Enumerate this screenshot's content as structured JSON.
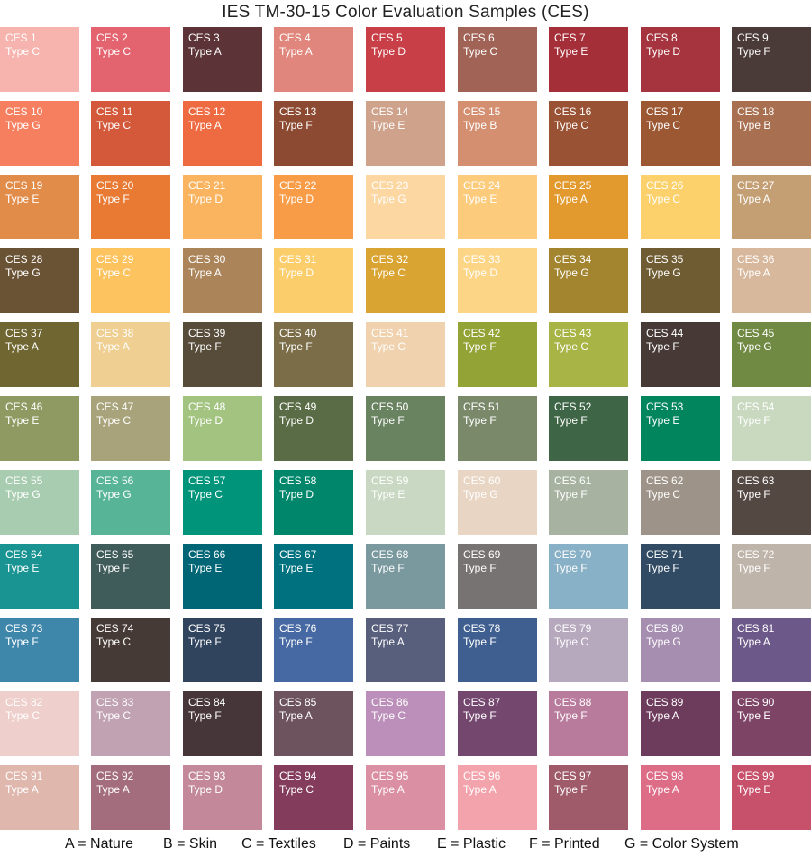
{
  "title": "IES TM-30-15 Color Evaluation Samples (CES)",
  "samples": [
    {
      "id": "CES 1",
      "type": "Type C",
      "color": "#f7b4ae"
    },
    {
      "id": "CES 2",
      "type": "Type C",
      "color": "#e3636f"
    },
    {
      "id": "CES 3",
      "type": "Type A",
      "color": "#5c3437"
    },
    {
      "id": "CES 4",
      "type": "Type A",
      "color": "#e0867c"
    },
    {
      "id": "CES 5",
      "type": "Type D",
      "color": "#c93f48"
    },
    {
      "id": "CES 6",
      "type": "Type C",
      "color": "#a06356"
    },
    {
      "id": "CES 7",
      "type": "Type E",
      "color": "#a52f39"
    },
    {
      "id": "CES 8",
      "type": "Type D",
      "color": "#a6343e"
    },
    {
      "id": "CES 9",
      "type": "Type F",
      "color": "#4a3a38"
    },
    {
      "id": "CES 10",
      "type": "Type G",
      "color": "#f57f5f"
    },
    {
      "id": "CES 11",
      "type": "Type C",
      "color": "#d4593a"
    },
    {
      "id": "CES 12",
      "type": "Type A",
      "color": "#ee6a40"
    },
    {
      "id": "CES 13",
      "type": "Type F",
      "color": "#8d4a32"
    },
    {
      "id": "CES 14",
      "type": "Type E",
      "color": "#cfa28c"
    },
    {
      "id": "CES 15",
      "type": "Type B",
      "color": "#d48f71"
    },
    {
      "id": "CES 16",
      "type": "Type C",
      "color": "#995233"
    },
    {
      "id": "CES 17",
      "type": "Type C",
      "color": "#9c5733"
    },
    {
      "id": "CES 18",
      "type": "Type B",
      "color": "#a86f51"
    },
    {
      "id": "CES 19",
      "type": "Type E",
      "color": "#e28c4a"
    },
    {
      "id": "CES 20",
      "type": "Type F",
      "color": "#e87a33"
    },
    {
      "id": "CES 21",
      "type": "Type D",
      "color": "#fab35f"
    },
    {
      "id": "CES 22",
      "type": "Type D",
      "color": "#f89c48"
    },
    {
      "id": "CES 23",
      "type": "Type G",
      "color": "#fcd7a2"
    },
    {
      "id": "CES 24",
      "type": "Type E",
      "color": "#fccb7b"
    },
    {
      "id": "CES 25",
      "type": "Type A",
      "color": "#e29a2f"
    },
    {
      "id": "CES 26",
      "type": "Type C",
      "color": "#fcd16b"
    },
    {
      "id": "CES 27",
      "type": "Type A",
      "color": "#c49f74"
    },
    {
      "id": "CES 28",
      "type": "Type G",
      "color": "#6a5234"
    },
    {
      "id": "CES 29",
      "type": "Type C",
      "color": "#fcc35e"
    },
    {
      "id": "CES 30",
      "type": "Type A",
      "color": "#ac8459"
    },
    {
      "id": "CES 31",
      "type": "Type D",
      "color": "#fccd6b"
    },
    {
      "id": "CES 32",
      "type": "Type C",
      "color": "#daa432"
    },
    {
      "id": "CES 33",
      "type": "Type D",
      "color": "#fcd587"
    },
    {
      "id": "CES 34",
      "type": "Type G",
      "color": "#a3842f"
    },
    {
      "id": "CES 35",
      "type": "Type G",
      "color": "#6f5c32"
    },
    {
      "id": "CES 36",
      "type": "Type A",
      "color": "#d8b89c"
    },
    {
      "id": "CES 37",
      "type": "Type A",
      "color": "#6f6631"
    },
    {
      "id": "CES 38",
      "type": "Type A",
      "color": "#efcf92"
    },
    {
      "id": "CES 39",
      "type": "Type F",
      "color": "#574b3a"
    },
    {
      "id": "CES 40",
      "type": "Type F",
      "color": "#7a6d48"
    },
    {
      "id": "CES 41",
      "type": "Type C",
      "color": "#f0d2ae"
    },
    {
      "id": "CES 42",
      "type": "Type F",
      "color": "#93a335"
    },
    {
      "id": "CES 43",
      "type": "Type C",
      "color": "#a8b446"
    },
    {
      "id": "CES 44",
      "type": "Type F",
      "color": "#473a36"
    },
    {
      "id": "CES 45",
      "type": "Type G",
      "color": "#708a44"
    },
    {
      "id": "CES 46",
      "type": "Type E",
      "color": "#8f9a62"
    },
    {
      "id": "CES 47",
      "type": "Type C",
      "color": "#a8a37a"
    },
    {
      "id": "CES 48",
      "type": "Type D",
      "color": "#a3c380"
    },
    {
      "id": "CES 49",
      "type": "Type D",
      "color": "#5a6c46"
    },
    {
      "id": "CES 50",
      "type": "Type F",
      "color": "#698360"
    },
    {
      "id": "CES 51",
      "type": "Type F",
      "color": "#7b896b"
    },
    {
      "id": "CES 52",
      "type": "Type F",
      "color": "#3e6646"
    },
    {
      "id": "CES 53",
      "type": "Type E",
      "color": "#00855c"
    },
    {
      "id": "CES 54",
      "type": "Type F",
      "color": "#c9d9c0"
    },
    {
      "id": "CES 55",
      "type": "Type G",
      "color": "#a8ccb0"
    },
    {
      "id": "CES 56",
      "type": "Type G",
      "color": "#58b497"
    },
    {
      "id": "CES 57",
      "type": "Type C",
      "color": "#00957b"
    },
    {
      "id": "CES 58",
      "type": "Type D",
      "color": "#00866b"
    },
    {
      "id": "CES 59",
      "type": "Type E",
      "color": "#c8d8c2"
    },
    {
      "id": "CES 60",
      "type": "Type G",
      "color": "#e8d5c4"
    },
    {
      "id": "CES 61",
      "type": "Type F",
      "color": "#a7b3a0"
    },
    {
      "id": "CES 62",
      "type": "Type C",
      "color": "#9e9388"
    },
    {
      "id": "CES 63",
      "type": "Type F",
      "color": "#544843"
    },
    {
      "id": "CES 64",
      "type": "Type E",
      "color": "#1a9493"
    },
    {
      "id": "CES 65",
      "type": "Type F",
      "color": "#3f5c5a"
    },
    {
      "id": "CES 66",
      "type": "Type E",
      "color": "#006676"
    },
    {
      "id": "CES 67",
      "type": "Type E",
      "color": "#00727f"
    },
    {
      "id": "CES 68",
      "type": "Type F",
      "color": "#7a999e"
    },
    {
      "id": "CES 69",
      "type": "Type F",
      "color": "#787373"
    },
    {
      "id": "CES 70",
      "type": "Type F",
      "color": "#88b0c6"
    },
    {
      "id": "CES 71",
      "type": "Type F",
      "color": "#304b63"
    },
    {
      "id": "CES 72",
      "type": "Type F",
      "color": "#bfb4aa"
    },
    {
      "id": "CES 73",
      "type": "Type F",
      "color": "#3f86ab"
    },
    {
      "id": "CES 74",
      "type": "Type C",
      "color": "#463a37"
    },
    {
      "id": "CES 75",
      "type": "Type F",
      "color": "#31445e"
    },
    {
      "id": "CES 76",
      "type": "Type F",
      "color": "#4769a3"
    },
    {
      "id": "CES 77",
      "type": "Type A",
      "color": "#575f7d"
    },
    {
      "id": "CES 78",
      "type": "Type F",
      "color": "#3e5f90"
    },
    {
      "id": "CES 79",
      "type": "Type C",
      "color": "#b6a8bd"
    },
    {
      "id": "CES 80",
      "type": "Type G",
      "color": "#a68eb1"
    },
    {
      "id": "CES 81",
      "type": "Type A",
      "color": "#6c5889"
    },
    {
      "id": "CES 82",
      "type": "Type C",
      "color": "#eecfcb"
    },
    {
      "id": "CES 83",
      "type": "Type C",
      "color": "#c1a2b2"
    },
    {
      "id": "CES 84",
      "type": "Type F",
      "color": "#463539"
    },
    {
      "id": "CES 85",
      "type": "Type A",
      "color": "#6d535e"
    },
    {
      "id": "CES 86",
      "type": "Type C",
      "color": "#bb8fba"
    },
    {
      "id": "CES 87",
      "type": "Type F",
      "color": "#74476f"
    },
    {
      "id": "CES 88",
      "type": "Type F",
      "color": "#b97b9c"
    },
    {
      "id": "CES 89",
      "type": "Type A",
      "color": "#6d3b5b"
    },
    {
      "id": "CES 90",
      "type": "Type E",
      "color": "#7d4466"
    },
    {
      "id": "CES 91",
      "type": "Type A",
      "color": "#dfb7ad"
    },
    {
      "id": "CES 92",
      "type": "Type A",
      "color": "#a36d7d"
    },
    {
      "id": "CES 93",
      "type": "Type D",
      "color": "#c3899b"
    },
    {
      "id": "CES 94",
      "type": "Type C",
      "color": "#833c5c"
    },
    {
      "id": "CES 95",
      "type": "Type A",
      "color": "#db8fa3"
    },
    {
      "id": "CES 96",
      "type": "Type A",
      "color": "#f3a3ab"
    },
    {
      "id": "CES 97",
      "type": "Type F",
      "color": "#a05b6a"
    },
    {
      "id": "CES 98",
      "type": "Type A",
      "color": "#dd6c86"
    },
    {
      "id": "CES 99",
      "type": "Type E",
      "color": "#c7506b"
    }
  ],
  "legend": [
    "A = Nature",
    "B = Skin",
    "C = Textiles",
    "D = Paints",
    "E = Plastic",
    "F = Printed",
    "G = Color System"
  ]
}
